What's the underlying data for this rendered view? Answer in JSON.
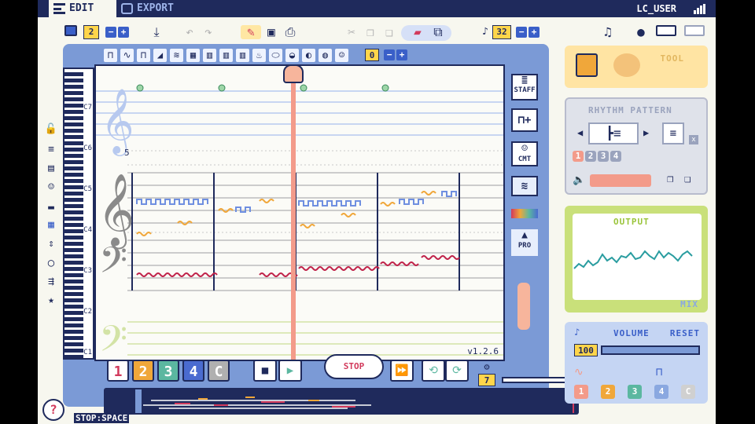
{
  "tabs": [
    {
      "label": "EDIT"
    },
    {
      "label": "EXPORT"
    }
  ],
  "user": {
    "name": "LC_USER"
  },
  "toolbar": {
    "page_value": "2",
    "bar_value": "32",
    "icons": [
      "folder-icon",
      "download-icon",
      "undo-icon",
      "redo-icon",
      "pencil-icon",
      "save-icon",
      "printer-icon",
      "scissors-icon",
      "copy-icon",
      "paste-icon",
      "eraser-icon",
      "select-icon"
    ]
  },
  "instruments": {
    "value": "0",
    "list": [
      "square-wave",
      "sine-wave",
      "pulse-wave",
      "saw-wave",
      "noise-wave",
      "piano",
      "organ",
      "marimba",
      "drum",
      "guitar",
      "trumpet",
      "cat",
      "robot",
      "bird",
      "ghost"
    ]
  },
  "keyboard": {
    "labels": [
      "C7",
      "C6",
      "C5",
      "C4",
      "C3",
      "C2",
      "C1"
    ]
  },
  "staff": {
    "measure_number": "5",
    "version": "v1.2.6"
  },
  "right_tools": {
    "staff_label": "STAFF",
    "pro_label": "PRO",
    "cmt_label": "CMT"
  },
  "tracks": [
    {
      "label": "1",
      "color": "#d23a5c"
    },
    {
      "label": "2",
      "color": "#f0a73a"
    },
    {
      "label": "3",
      "color": "#5bb7a0"
    },
    {
      "label": "4",
      "color": "#4a6bd0"
    },
    {
      "label": "C",
      "color": "#b0b0b0"
    }
  ],
  "transport": {
    "stop_label": "STOP",
    "tempo_value": "7"
  },
  "timeline": {
    "count": "50"
  },
  "hint": {
    "text": "STOP:SPACE"
  },
  "panels": {
    "tool": {
      "title": "TOOL"
    },
    "rhythm": {
      "title": "RHYTHM PATTERN",
      "numbers": [
        "1",
        "2",
        "3",
        "4"
      ],
      "multiplier": "x"
    },
    "output": {
      "title": "OUTPUT",
      "mode": "MIX"
    },
    "volume": {
      "title": "VOLUME",
      "reset": "RESET",
      "value": "100",
      "level": 1.0
    },
    "track_labels": [
      "1",
      "2",
      "3",
      "4",
      "C"
    ]
  },
  "colors": {
    "accent": "#3a5fc8",
    "frame": "#7b9ad6",
    "playhead": "#f39b8a",
    "track1": "#d23a5c",
    "track2": "#f0a73a",
    "track3": "#5bb7a0"
  }
}
